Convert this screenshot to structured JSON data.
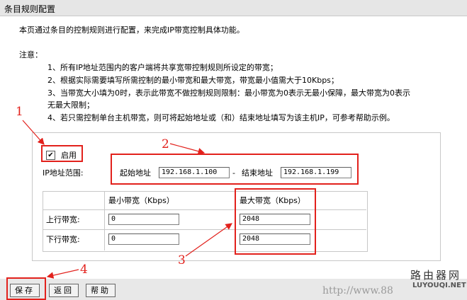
{
  "title": "条目规则配置",
  "intro": "本页通过条目的控制规则进行配置，来完成IP带宽控制具体功能。",
  "notes": {
    "heading": "注意：",
    "line1": "1、所有IP地址范围内的客户端将共享宽带控制规则所设定的带宽；",
    "line2": "2、根据实际需要填写所需控制的最小带宽和最大带宽，带宽最小值需大于10Kbps；",
    "line3a": "3、当带宽大小填为0时，表示此带宽不做控制规则限制：最小带宽为0表示无最小保障，最大带宽为0表示",
    "line3b": "无最大限制；",
    "line4": "4、若只需控制单台主机带宽，则可将起始地址或（和）结束地址填写为该主机IP，可参考帮助示例。"
  },
  "form": {
    "enable_label": "启用",
    "enable_checked": true,
    "checkbox_mark": "✔",
    "ip_range_label": "IP地址范围:",
    "start_label": "起始地址",
    "start_value": "192.168.1.100",
    "dash": "-",
    "end_label": "结束地址",
    "end_value": "192.168.1.199",
    "col_min": "最小带宽（Kbps）",
    "col_max": "最大带宽（Kbps）",
    "row_up": "上行带宽:",
    "row_down": "下行带宽:",
    "up_min": "0",
    "up_max": "2048",
    "down_min": "0",
    "down_max": "2048"
  },
  "buttons": {
    "save": "保存",
    "back": "返回",
    "help": "帮助"
  },
  "annotations": {
    "n1": "1",
    "n2": "2",
    "n3": "3",
    "n4": "4",
    "color": "#e2211c"
  },
  "watermark": {
    "line1": "路由器网",
    "line2": "http://www.88",
    "line3": "LUYOUQI.NET"
  }
}
